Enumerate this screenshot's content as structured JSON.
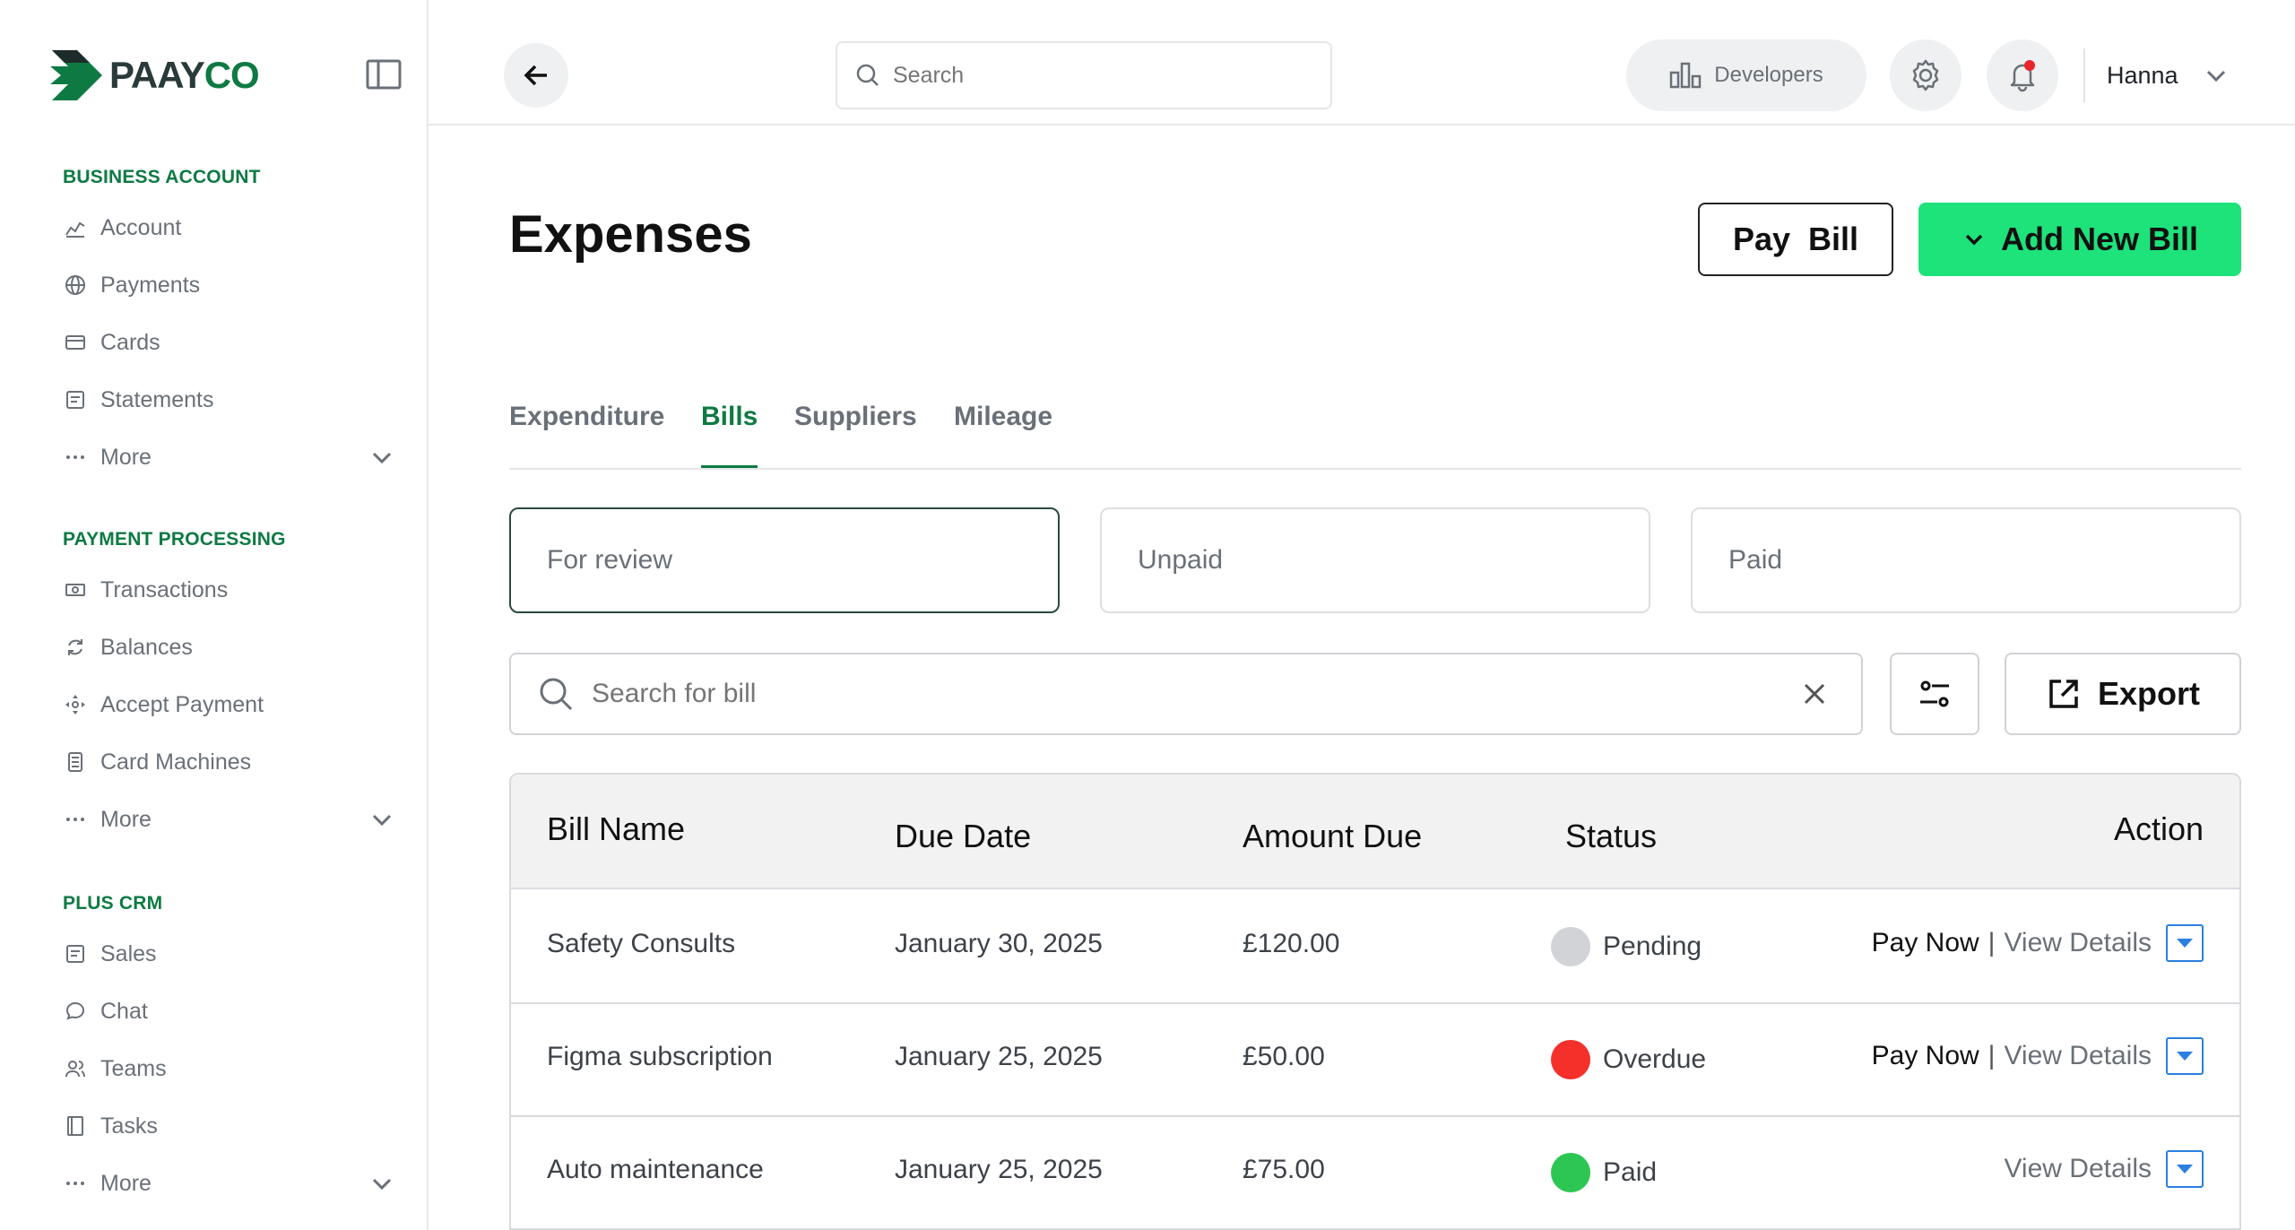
{
  "brand": {
    "name_part1": "PAAY",
    "name_part2": "CO",
    "accent": "#0e7a43",
    "cta": "#1ee27a"
  },
  "sidebar": {
    "sections": [
      {
        "title": "BUSINESS ACCOUNT",
        "items": [
          {
            "label": "Account",
            "icon": "chart-line-icon"
          },
          {
            "label": "Payments",
            "icon": "globe-icon"
          },
          {
            "label": "Cards",
            "icon": "card-icon"
          },
          {
            "label": "Statements",
            "icon": "document-icon"
          },
          {
            "label": "More",
            "icon": "ellipsis-icon"
          }
        ]
      },
      {
        "title": "PAYMENT PROCESSING",
        "items": [
          {
            "label": "Transactions",
            "icon": "cash-icon"
          },
          {
            "label": "Balances",
            "icon": "refresh-icon"
          },
          {
            "label": "Accept Payment",
            "icon": "move-arrows-icon"
          },
          {
            "label": "Card Machines",
            "icon": "terminal-icon"
          },
          {
            "label": "More",
            "icon": "ellipsis-icon"
          }
        ]
      },
      {
        "title": "PLUS CRM",
        "items": [
          {
            "label": "Sales",
            "icon": "document-icon"
          },
          {
            "label": "Chat",
            "icon": "chat-bubble-icon"
          },
          {
            "label": "Teams",
            "icon": "users-icon"
          },
          {
            "label": "Tasks",
            "icon": "notebook-icon"
          },
          {
            "label": "More",
            "icon": "ellipsis-icon"
          }
        ]
      }
    ]
  },
  "topbar": {
    "search_placeholder": "Search",
    "developers_label": "Developers",
    "user_name": "Hanna"
  },
  "page": {
    "title": "Expenses",
    "pay_bill_label": "Pay  Bill",
    "add_bill_label": "Add New Bill",
    "tabs": [
      {
        "label": "Expenditure",
        "active": false
      },
      {
        "label": "Bills",
        "active": true
      },
      {
        "label": "Suppliers",
        "active": false
      },
      {
        "label": "Mileage",
        "active": false
      }
    ],
    "filters": [
      "For review",
      "Unpaid",
      "Paid"
    ],
    "bill_search_placeholder": "Search for bill",
    "export_label": "Export"
  },
  "table": {
    "headers": {
      "name": "Bill Name",
      "due": "Due Date",
      "amount": "Amount Due",
      "status": "Status",
      "action": "Action"
    },
    "rows": [
      {
        "name": "Safety Consults",
        "due": "January 30, 2025",
        "amount": "£120.00",
        "status": "Pending",
        "status_color": "#d1d3d6",
        "pay_now": "Pay Now",
        "view": "View Details"
      },
      {
        "name": "Figma subscription",
        "due": "January 25, 2025",
        "amount": "£50.00",
        "status": "Overdue",
        "status_color": "#f5302a",
        "pay_now": "Pay Now",
        "view": "View Details"
      },
      {
        "name": "Auto maintenance",
        "due": "January 25, 2025",
        "amount": "£75.00",
        "status": "Paid",
        "status_color": "#2ec653",
        "pay_now": "",
        "view": "View Details"
      }
    ]
  }
}
